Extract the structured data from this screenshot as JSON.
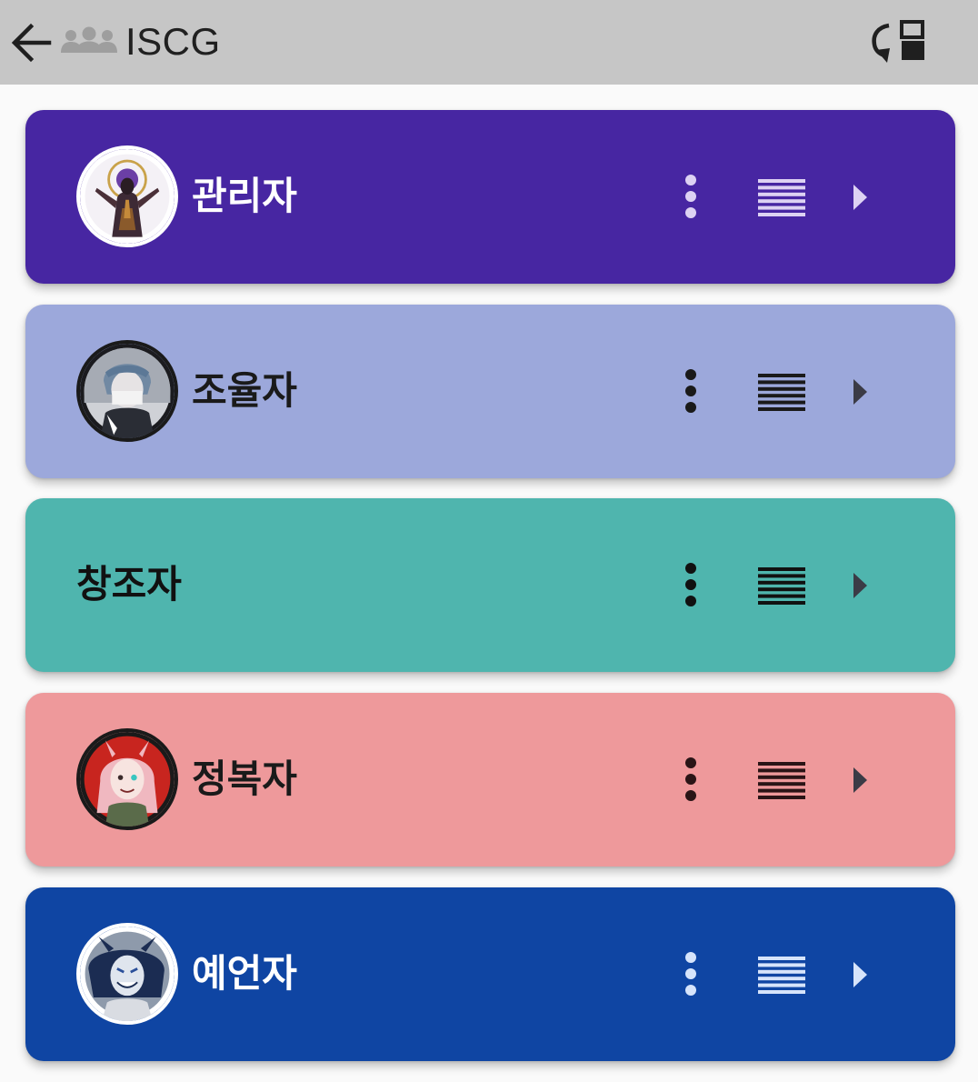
{
  "header": {
    "title": "ISCG",
    "back_icon": "arrow-left-icon",
    "group_icon": "group-icon",
    "switch_icon": "switch-layout-icon"
  },
  "colors": {
    "header_bg": "#c6c6c6",
    "page_bg": "#fafafa"
  },
  "roles": [
    {
      "name": "관리자",
      "bg": "#4726a2",
      "fg": "#ffffff",
      "icon_fg": "#ddd2f3",
      "has_avatar": true
    },
    {
      "name": "조율자",
      "bg": "#9ca8db",
      "fg": "#1a1a1a",
      "icon_fg": "#1a1a1a",
      "has_avatar": true
    },
    {
      "name": "창조자",
      "bg": "#4fb5ae",
      "fg": "#111111",
      "icon_fg": "#111111",
      "has_avatar": false
    },
    {
      "name": "정복자",
      "bg": "#ee999b",
      "fg": "#1a1a1a",
      "icon_fg": "#2a1416",
      "has_avatar": true
    },
    {
      "name": "예언자",
      "bg": "#0f45a3",
      "fg": "#ffffff",
      "icon_fg": "#d6e4fb",
      "has_avatar": true
    }
  ]
}
